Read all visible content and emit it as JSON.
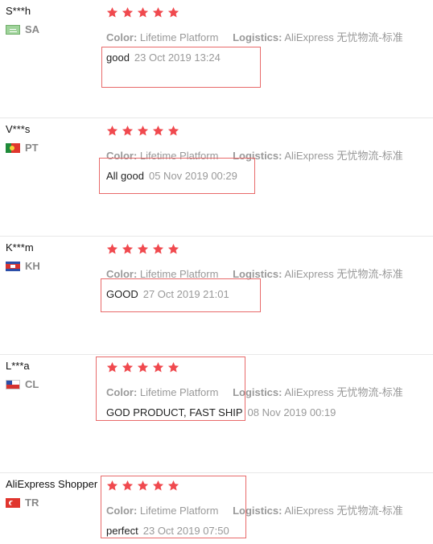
{
  "labels": {
    "color": "Color:",
    "logistics": "Logistics:"
  },
  "colors": {
    "star": "#f0494e",
    "highlight": "#e86a6a"
  },
  "reviews": [
    {
      "user": "S***h",
      "country": "SA",
      "flag": "saudi-arabia-flag",
      "rating": 5,
      "color": "Lifetime Platform",
      "logistics": "AliExpress 无忧物流-标准",
      "feedback": "good",
      "date": "23 Oct 2019 13:24"
    },
    {
      "user": "V***s",
      "country": "PT",
      "flag": "portugal-flag",
      "rating": 5,
      "color": "Lifetime Platform",
      "logistics": "AliExpress 无忧物流-标准",
      "feedback": "All good",
      "date": "05 Nov 2019 00:29"
    },
    {
      "user": "K***m",
      "country": "KH",
      "flag": "cambodia-flag",
      "rating": 5,
      "color": "Lifetime Platform",
      "logistics": "AliExpress 无忧物流-标准",
      "feedback": "GOOD",
      "date": "27 Oct 2019 21:01"
    },
    {
      "user": "L***a",
      "country": "CL",
      "flag": "chile-flag",
      "rating": 5,
      "color": "Lifetime Platform",
      "logistics": "AliExpress 无忧物流-标准",
      "feedback": "GOD PRODUCT, FAST SHIP",
      "date": "08 Nov 2019 00:19"
    },
    {
      "user": "AliExpress Shopper",
      "country": "TR",
      "flag": "turkey-flag",
      "rating": 5,
      "color": "Lifetime Platform",
      "logistics": "AliExpress 无忧物流-标准",
      "feedback": "perfect",
      "date": "23 Oct 2019 07:50"
    }
  ]
}
